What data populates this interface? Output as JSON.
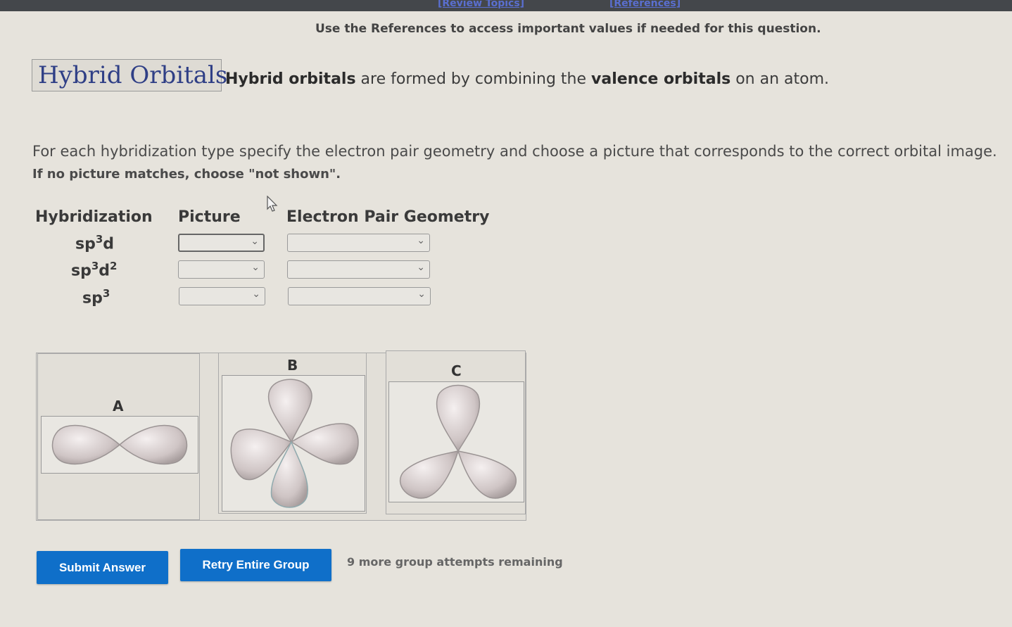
{
  "topbar": {
    "review_topics": "[Review Topics]",
    "references": "[References]"
  },
  "notice": "Use the References to access important values if needed for this question.",
  "title": "Hybrid Orbitals",
  "intro": {
    "part1": "Hybrid orbitals",
    "part2": " are formed by combining the ",
    "part3": "valence orbitals",
    "part4": " on an atom."
  },
  "instructions": {
    "line1": "For each hybridization type specify the electron pair geometry and choose a picture that corresponds to the correct orbital image.",
    "line2": "If no picture matches, choose \"not shown\"."
  },
  "table": {
    "headers": {
      "hybridization": "Hybridization",
      "picture": "Picture",
      "geometry": "Electron Pair Geometry"
    },
    "rows": [
      {
        "base": "sp",
        "sup1": "3",
        "mid": "d",
        "sup2": "",
        "picture_value": "",
        "geometry_value": ""
      },
      {
        "base": "sp",
        "sup1": "3",
        "mid": "d",
        "sup2": "2",
        "picture_value": "",
        "geometry_value": ""
      },
      {
        "base": "sp",
        "sup1": "3",
        "mid": "",
        "sup2": "",
        "picture_value": "",
        "geometry_value": ""
      }
    ]
  },
  "pictures": {
    "a": "A",
    "b": "B",
    "c": "C"
  },
  "buttons": {
    "submit": "Submit Answer",
    "retry": "Retry Entire Group"
  },
  "attempts": "9 more group attempts remaining",
  "icons": {
    "dropdown": "chevron-down-icon",
    "cursor": "mouse-cursor-icon"
  },
  "colors": {
    "title": "#2f3f86",
    "button": "#0f6fc9",
    "topbar": "#44474b"
  }
}
